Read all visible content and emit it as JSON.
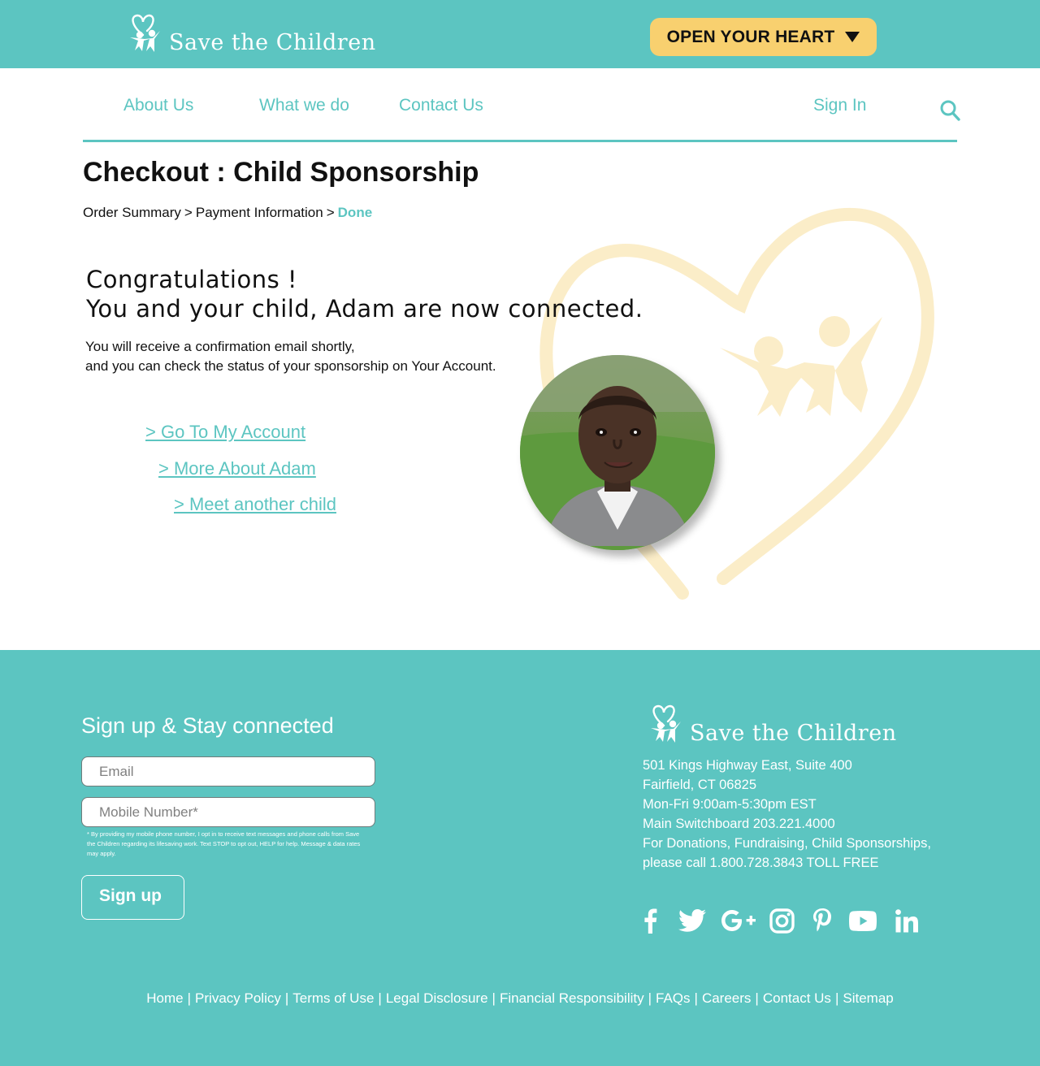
{
  "brand": {
    "name": "Save the Children",
    "accent_color": "#5cc5c1",
    "cta_color": "#f8d06f",
    "heart_color": "#fbedc8"
  },
  "header": {
    "cta_label": "OPEN YOUR HEART",
    "cta_icon": "caret-down-icon"
  },
  "nav": {
    "items": [
      {
        "label": "About Us"
      },
      {
        "label": "What we do"
      },
      {
        "label": "Contact Us"
      }
    ],
    "sign_in": "Sign In",
    "search_icon": "search-icon"
  },
  "main": {
    "title": "Checkout : Child Sponsorship",
    "breadcrumb": {
      "steps": [
        "Order Summary",
        "Payment Information",
        "Done"
      ],
      "separator": ">"
    },
    "congrats_line1": "Congratulations !",
    "congrats_line2": "You and your child, Adam are now connected.",
    "info_line1": "You will receive a confirmation email shortly,",
    "info_line2": "and you can check the status of your sponsorship on Your Account.",
    "links": [
      {
        "label": "> Go To My Account"
      },
      {
        "label": "> More About Adam"
      },
      {
        "label": "> Meet another child"
      }
    ]
  },
  "footer": {
    "signup_title": "Sign up & Stay connected",
    "email_placeholder": "Email",
    "mobile_placeholder": "Mobile Number*",
    "disclaimer": "* By providing my mobile phone number, I opt in to receive text messages and phone calls from Save the Children regarding its lifesaving work. Text STOP to opt out, HELP for help. Message & data rates may apply.",
    "signup_button": "Sign up",
    "address": [
      "501 Kings Highway East, Suite 400",
      "Fairfield, CT 06825",
      "Mon-Fri 9:00am-5:30pm EST",
      "Main Switchboard 203.221.4000",
      "For Donations, Fundraising, Child Sponsorships,",
      "please call 1.800.728.3843 TOLL FREE"
    ],
    "social": [
      "facebook-icon",
      "twitter-icon",
      "google-plus-icon",
      "instagram-icon",
      "pinterest-icon",
      "youtube-icon",
      "linkedin-icon"
    ],
    "links": [
      "Home",
      "Privacy Policy",
      "Terms of Use",
      "Legal Disclosure",
      "Financial Responsibility",
      "FAQs",
      "Careers",
      "Contact Us",
      "Sitemap"
    ],
    "link_separator": "|"
  }
}
